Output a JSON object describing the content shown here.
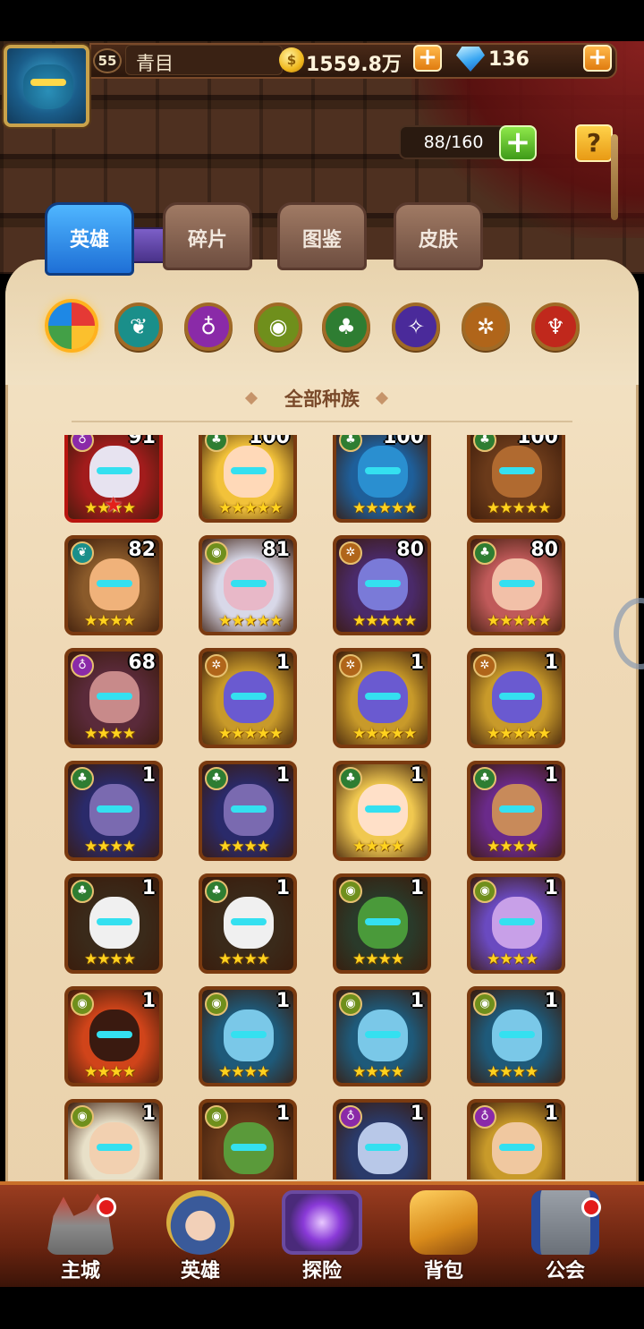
{
  "player": {
    "level": "55",
    "name": "青目",
    "gold": "1559.8万",
    "gold_icon_label": "$",
    "gems": "136"
  },
  "hero_count": "88/160",
  "help_label": "?",
  "plus_label": "+",
  "tabs": [
    {
      "label": "英雄",
      "active": true
    },
    {
      "label": "碎片",
      "active": false
    },
    {
      "label": "图鉴",
      "active": false
    },
    {
      "label": "皮肤",
      "active": false
    }
  ],
  "race_filters": [
    {
      "name": "all",
      "icon": "rainbow-swirl-icon",
      "color": "#e53935"
    },
    {
      "name": "forest",
      "icon": "wing-emblem-icon",
      "color": "#1a8f8a"
    },
    {
      "name": "shadow",
      "icon": "ghost-emblem-icon",
      "color": "#8a2aa8"
    },
    {
      "name": "fortress",
      "icon": "eye-emblem-icon",
      "color": "#6f8f1c"
    },
    {
      "name": "abyss",
      "icon": "leaf-emblem-icon",
      "color": "#2e7d32"
    },
    {
      "name": "dark",
      "icon": "demon-emblem-icon",
      "color": "#4a2a9a"
    },
    {
      "name": "light",
      "icon": "sun-emblem-icon",
      "color": "#b0651a"
    },
    {
      "name": "transcendence",
      "icon": "flame-emblem-icon",
      "color": "#c0281c"
    }
  ],
  "race_title": "全部种族",
  "heroes": [
    {
      "level": "91",
      "race": "shadow",
      "stars": 4,
      "red_star": true,
      "tone": "#e7e3f0",
      "bg": "#a21c1c"
    },
    {
      "level": "100",
      "race": "abyss",
      "stars": 5,
      "tone": "#ffd9b8",
      "bg": "#f2c23a"
    },
    {
      "level": "100",
      "race": "abyss",
      "stars": 5,
      "tone": "#2a8fd0",
      "bg": "#1e5f9a"
    },
    {
      "level": "100",
      "race": "abyss",
      "stars": 5,
      "tone": "#b06a30",
      "bg": "#6a3a1a"
    },
    {
      "level": "82",
      "race": "forest",
      "stars": 4,
      "tone": "#f0b27a",
      "bg": "#8a5a2a"
    },
    {
      "level": "81",
      "race": "fortress",
      "stars": 5,
      "tone": "#e8b8c8",
      "bg": "#d8d8e8"
    },
    {
      "level": "80",
      "race": "light",
      "stars": 5,
      "tone": "#7a7ad8",
      "bg": "#4a2a6a"
    },
    {
      "level": "80",
      "race": "abyss",
      "stars": 5,
      "tone": "#f2c0a8",
      "bg": "#c05a5a"
    },
    {
      "level": "68",
      "race": "shadow",
      "stars": 4,
      "tone": "#c88a8a",
      "bg": "#5a2a3a"
    },
    {
      "level": "1",
      "race": "light",
      "stars": 5,
      "tone": "#6a5ad0",
      "bg": "#c89a2a"
    },
    {
      "level": "1",
      "race": "light",
      "stars": 5,
      "tone": "#6a5ad0",
      "bg": "#c89a2a"
    },
    {
      "level": "1",
      "race": "light",
      "stars": 5,
      "tone": "#6a5ad0",
      "bg": "#c89a2a"
    },
    {
      "level": "1",
      "race": "abyss",
      "stars": 4,
      "tone": "#7a6ab0",
      "bg": "#2a2a6a"
    },
    {
      "level": "1",
      "race": "abyss",
      "stars": 4,
      "tone": "#7a6ab0",
      "bg": "#2a2a6a"
    },
    {
      "level": "1",
      "race": "abyss",
      "stars": 4,
      "tone": "#ffe0c8",
      "bg": "#f0c850"
    },
    {
      "level": "1",
      "race": "abyss",
      "stars": 4,
      "tone": "#c88a5a",
      "bg": "#6a2a8a"
    },
    {
      "level": "1",
      "race": "abyss",
      "stars": 4,
      "tone": "#f0f0f0",
      "bg": "#3a2a1a"
    },
    {
      "level": "1",
      "race": "abyss",
      "stars": 4,
      "tone": "#f0f0f0",
      "bg": "#3a2a1a"
    },
    {
      "level": "1",
      "race": "fortress",
      "stars": 4,
      "tone": "#4a9a3a",
      "bg": "#2a3a2a"
    },
    {
      "level": "1",
      "race": "fortress",
      "stars": 4,
      "tone": "#c8a0e8",
      "bg": "#6a4ac0"
    },
    {
      "level": "1",
      "race": "fortress",
      "stars": 4,
      "tone": "#3a1a10",
      "bg": "#d0441a"
    },
    {
      "level": "1",
      "race": "fortress",
      "stars": 4,
      "tone": "#7ac8e8",
      "bg": "#1e5a7a"
    },
    {
      "level": "1",
      "race": "fortress",
      "stars": 4,
      "tone": "#7ac8e8",
      "bg": "#1e5a7a"
    },
    {
      "level": "1",
      "race": "fortress",
      "stars": 4,
      "tone": "#7ac8e8",
      "bg": "#1e5a7a"
    },
    {
      "level": "1",
      "race": "fortress",
      "stars": 0,
      "tone": "#f2d0b0",
      "bg": "#e8e0c8"
    },
    {
      "level": "1",
      "race": "fortress",
      "stars": 0,
      "tone": "#5a9a3a",
      "bg": "#6a3a1a"
    },
    {
      "level": "1",
      "race": "shadow",
      "stars": 0,
      "tone": "#b8c8e8",
      "bg": "#2a3a6a"
    },
    {
      "level": "1",
      "race": "shadow",
      "stars": 0,
      "tone": "#f0c8a0",
      "bg": "#c89a2a"
    }
  ],
  "nav": [
    {
      "label": "主城",
      "icon": "castle-icon",
      "badge": true
    },
    {
      "label": "英雄",
      "icon": "hero-portrait-icon",
      "badge": false
    },
    {
      "label": "探险",
      "icon": "portal-icon",
      "badge": false
    },
    {
      "label": "背包",
      "icon": "backpack-icon",
      "badge": false
    },
    {
      "label": "公会",
      "icon": "guild-tower-icon",
      "badge": true
    }
  ]
}
